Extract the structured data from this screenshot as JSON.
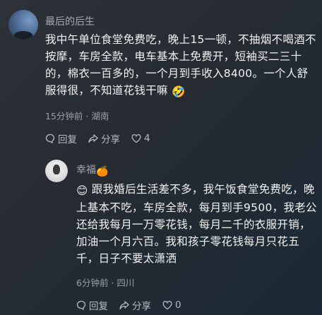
{
  "comment": {
    "username": "最后的后生",
    "text": "我中午单位食堂免费吃，晚上15一顿，不抽烟不喝酒不按摩，车房全款，电车基本上免费开，短袖买二三十的，棉衣一百多的，一个月到手收入8400。一个人舒服得很，不知道花钱干嘛",
    "emoji": "🤣",
    "time": "15分钟前",
    "location": "湖南",
    "actions": {
      "reply_label": "回复",
      "share_label": "分享",
      "like_count": "4"
    }
  },
  "reply": {
    "username": "幸福",
    "username_emoji": "🍊",
    "lead_emoji": "😊",
    "text": "跟我婚后生活差不多，我午饭食堂免费吃，晚上基本不吃，车房全款，每月到手9500，我老公还给我每月一万零花钱，每月二千的衣服开销，加油一个月六百。我和孩子零花钱每月只花五千，日子不要太潇洒",
    "time": "6分钟前",
    "location": "四川",
    "actions": {
      "reply_label": "回复",
      "share_label": "分享",
      "like_count": "0"
    }
  },
  "meta_separator": " · "
}
